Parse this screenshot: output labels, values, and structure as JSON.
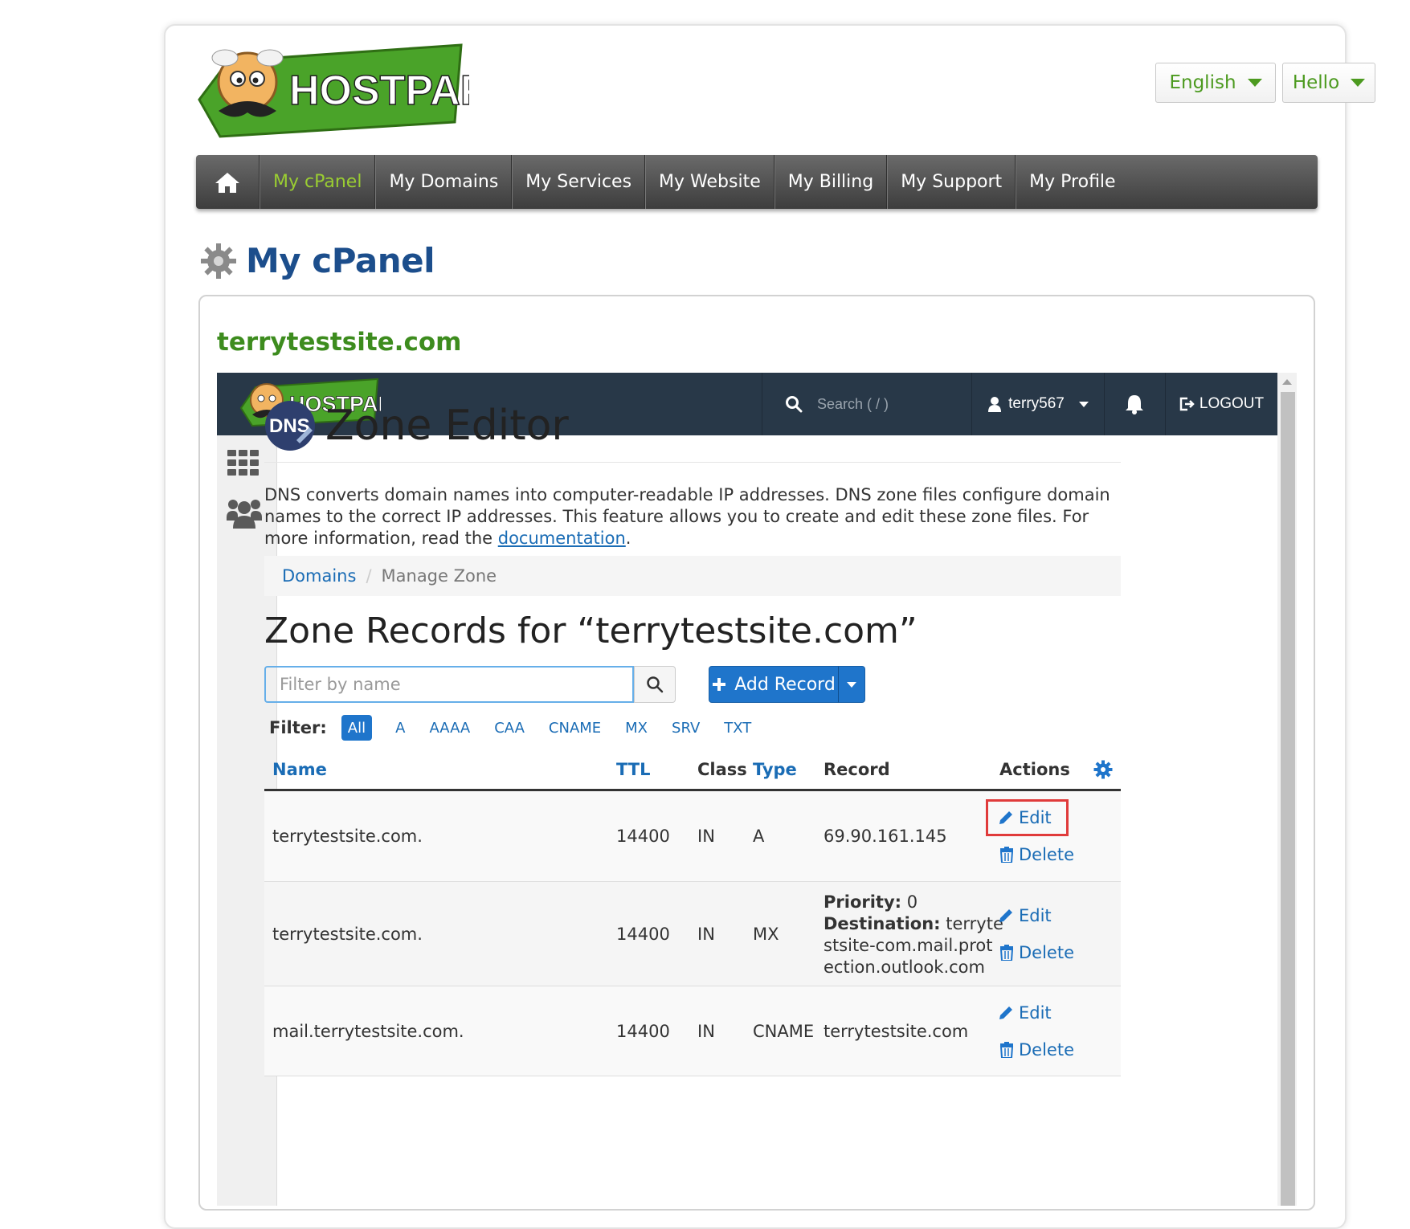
{
  "brand": {
    "logo_text": "HOSTPAPA"
  },
  "top_buttons": {
    "language": "English",
    "user": "Hello"
  },
  "nav": {
    "items": [
      "My cPanel",
      "My Domains",
      "My Services",
      "My Website",
      "My Billing",
      "My Support",
      "My Profile"
    ],
    "active": "My cPanel"
  },
  "page": {
    "title": "My cPanel",
    "domain": "terrytestsite.com"
  },
  "cpanel": {
    "logo_text": "HOSTPAPA",
    "search_placeholder": "Search ( / )",
    "username": "terry567",
    "logout": "LOGOUT",
    "app_title": "Zone Editor",
    "dns_badge": "DNS",
    "description": "DNS converts domain names into computer-readable IP addresses. DNS zone files configure domain names to the correct IP addresses. This feature allows you to create and edit these zone files. For more information, read the ",
    "description_link": "documentation",
    "description_end": ".",
    "breadcrumb": {
      "root": "Domains",
      "separator": "/",
      "current": "Manage Zone"
    },
    "records_title": "Zone Records for “terrytestsite.com”",
    "filter_placeholder": "Filter by name",
    "add_record": "Add Record",
    "filter_label": "Filter:",
    "filters": [
      "All",
      "A",
      "AAAA",
      "CAA",
      "CNAME",
      "MX",
      "SRV",
      "TXT"
    ],
    "columns": {
      "name": "Name",
      "ttl": "TTL",
      "class": "Class",
      "type": "Type",
      "record": "Record",
      "actions": "Actions"
    },
    "rows": [
      {
        "name": "terrytestsite.com.",
        "ttl": "14400",
        "class": "IN",
        "type": "A",
        "record": "69.90.161.145",
        "edit": "Edit",
        "delete": "Delete"
      },
      {
        "name": "terrytestsite.com.",
        "ttl": "14400",
        "class": "IN",
        "type": "MX",
        "priority_label": "Priority:",
        "priority": "0",
        "destination_label": "Destination:",
        "destination_1": "terryte",
        "destination_2": "stsite-com.mail.prot",
        "destination_3": "ection.outlook.com",
        "edit": "Edit",
        "delete": "Delete"
      },
      {
        "name": "mail.terrytestsite.com.",
        "ttl": "14400",
        "class": "IN",
        "type": "CNAME",
        "record": "terrytestsite.com",
        "edit": "Edit",
        "delete": "Delete"
      }
    ]
  },
  "colors": {
    "brand_green": "#4c9a1f",
    "heading_blue": "#1c4e8c",
    "link_blue": "#1a6cb5",
    "cp_header": "#283848",
    "highlight_red": "#e03b3b"
  }
}
